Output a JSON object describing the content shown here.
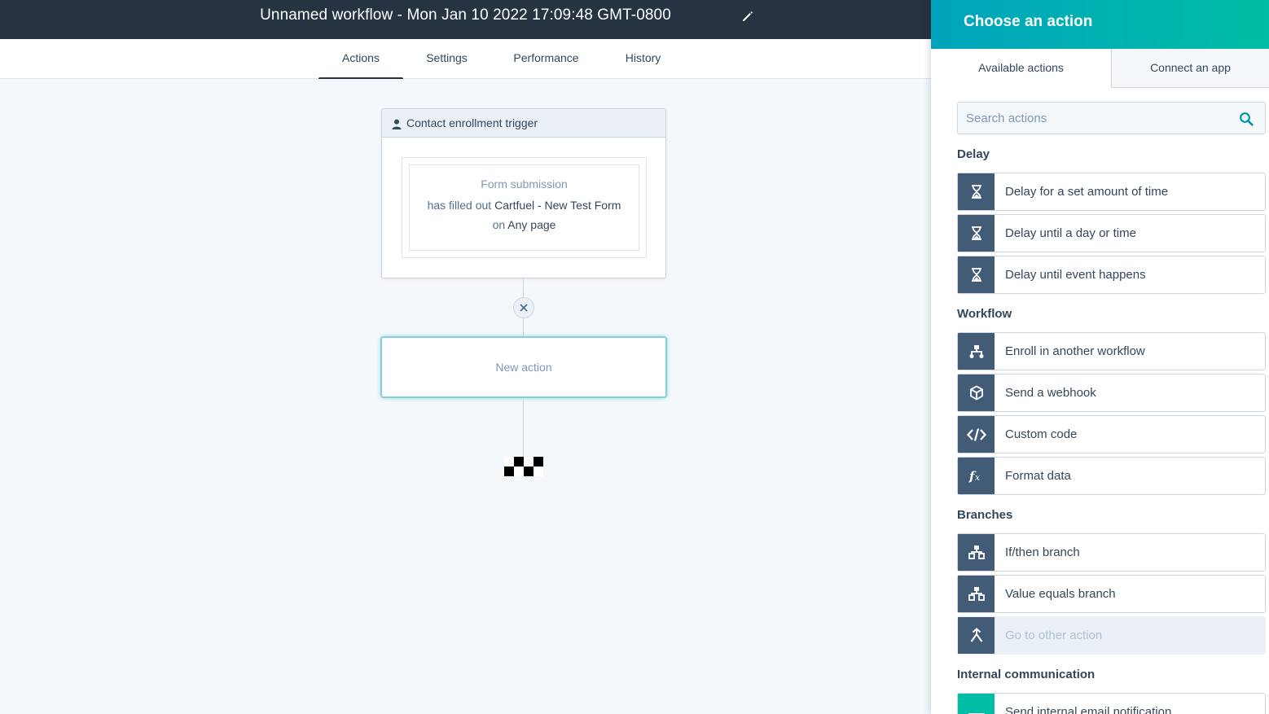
{
  "header": {
    "workflow_title": "Unnamed workflow - Mon Jan 10 2022 17:09:48 GMT-0800",
    "edit_icon": "pencil-icon"
  },
  "tabs": [
    {
      "label": "Actions",
      "active": true
    },
    {
      "label": "Settings",
      "active": false
    },
    {
      "label": "Performance",
      "active": false
    },
    {
      "label": "History",
      "active": false
    }
  ],
  "canvas": {
    "trigger": {
      "header_label": "Contact enrollment trigger",
      "icon": "person-icon",
      "criteria_type": "Form submission",
      "text_prefix": "has filled out",
      "form_name": "Cartfuel - New Test Form",
      "text_on": "on",
      "page_name": "Any page"
    },
    "remove_icon": "close-icon",
    "new_action_label": "New action",
    "end_icon": "checkered-flag-icon"
  },
  "panel": {
    "title": "Choose an action",
    "tabs": [
      {
        "label": "Available actions",
        "active": true
      },
      {
        "label": "Connect an app",
        "active": false
      }
    ],
    "search": {
      "placeholder": "Search actions",
      "value": "",
      "icon": "search-icon"
    },
    "sections": [
      {
        "title": "Delay",
        "actions": [
          {
            "label": "Delay for a set amount of time",
            "icon": "hourglass-icon"
          },
          {
            "label": "Delay until a day or time",
            "icon": "hourglass-icon"
          },
          {
            "label": "Delay until event happens",
            "icon": "hourglass-icon"
          }
        ]
      },
      {
        "title": "Workflow",
        "actions": [
          {
            "label": "Enroll in another workflow",
            "icon": "workflow-icon"
          },
          {
            "label": "Send a webhook",
            "icon": "cube-icon"
          },
          {
            "label": "Custom code",
            "icon": "code-icon"
          },
          {
            "label": "Format data",
            "icon": "function-icon"
          }
        ]
      },
      {
        "title": "Branches",
        "actions": [
          {
            "label": "If/then branch",
            "icon": "branch-icon"
          },
          {
            "label": "Value equals branch",
            "icon": "branch-icon"
          },
          {
            "label": "Go to other action",
            "icon": "merge-arrow-icon",
            "disabled": true
          }
        ]
      },
      {
        "title": "Internal communication",
        "actions": [
          {
            "label": "Send internal email notification",
            "icon": "envelope-icon"
          }
        ]
      }
    ]
  },
  "colors": {
    "header_bg": "#253342",
    "panel_gradient_start": "#00a4bd",
    "panel_gradient_end": "#00bda5",
    "icon_box": "#425b76",
    "highlight_border": "#7fd1de"
  }
}
